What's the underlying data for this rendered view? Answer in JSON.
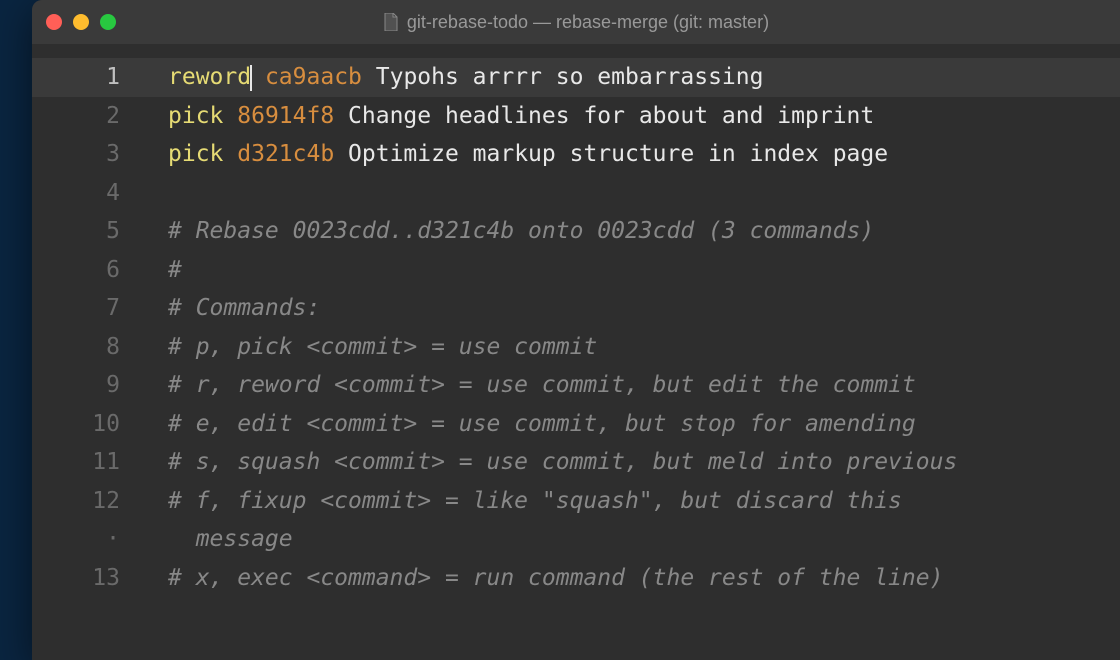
{
  "window": {
    "title": "git-rebase-todo — rebase-merge (git: master)"
  },
  "editor": {
    "lines": [
      {
        "n": "1",
        "active": true,
        "kind": "entry",
        "cmd": "reword",
        "cursor": true,
        "hash": "ca9aacb",
        "msg": "Typohs arrrr so embarrassing"
      },
      {
        "n": "2",
        "active": false,
        "kind": "entry",
        "cmd": "pick",
        "cursor": false,
        "hash": "86914f8",
        "msg": "Change headlines for about and imprint"
      },
      {
        "n": "3",
        "active": false,
        "kind": "entry",
        "cmd": "pick",
        "cursor": false,
        "hash": "d321c4b",
        "msg": "Optimize markup structure in index page"
      },
      {
        "n": "4",
        "active": false,
        "kind": "blank"
      },
      {
        "n": "5",
        "active": false,
        "kind": "comment",
        "text": "# Rebase 0023cdd..d321c4b onto 0023cdd (3 commands)"
      },
      {
        "n": "6",
        "active": false,
        "kind": "comment",
        "text": "#"
      },
      {
        "n": "7",
        "active": false,
        "kind": "comment",
        "text": "# Commands:"
      },
      {
        "n": "8",
        "active": false,
        "kind": "comment",
        "text": "# p, pick <commit> = use commit"
      },
      {
        "n": "9",
        "active": false,
        "kind": "comment",
        "text": "# r, reword <commit> = use commit, but edit the commit"
      },
      {
        "n": "10",
        "active": false,
        "kind": "comment",
        "text": "# e, edit <commit> = use commit, but stop for amending"
      },
      {
        "n": "11",
        "active": false,
        "kind": "comment",
        "text": "# s, squash <commit> = use commit, but meld into previous"
      },
      {
        "n": "12",
        "active": false,
        "kind": "comment",
        "text": "# f, fixup <commit> = like \"squash\", but discard this"
      },
      {
        "n": "·",
        "active": false,
        "kind": "comment-wrap",
        "text": "  message"
      },
      {
        "n": "13",
        "active": false,
        "kind": "comment",
        "text": "# x, exec <command> = run command (the rest of the line)"
      }
    ]
  }
}
